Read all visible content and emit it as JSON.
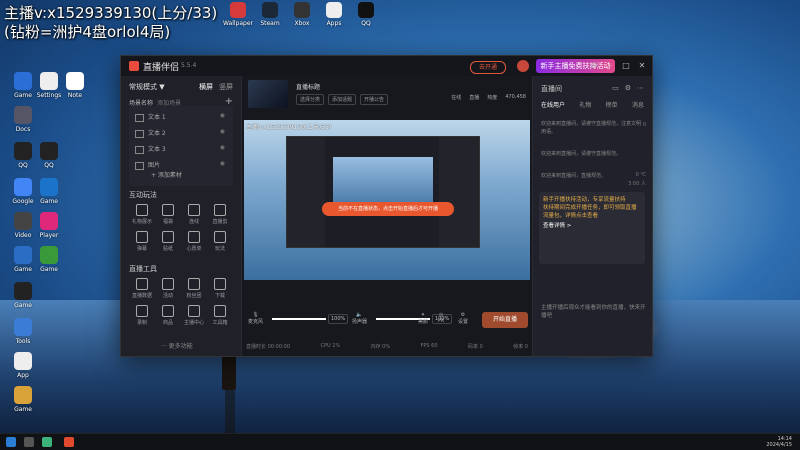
{
  "overlay": {
    "line1": "主播v:x1529339130(上分/33)",
    "line2": "(钻粉=洲护4盘orlol4局)"
  },
  "top_icons": [
    {
      "label": "Wallpaper"
    },
    {
      "label": "Steam"
    },
    {
      "label": "Xbox"
    },
    {
      "label": "Apps"
    },
    {
      "label": "QQ"
    }
  ],
  "desktop_icons": [
    {
      "label": "Game"
    },
    {
      "label": "Settings"
    },
    {
      "label": "Note"
    },
    {
      "label": "Docs"
    },
    {
      "label": "QQ"
    },
    {
      "label": "QQ"
    },
    {
      "label": "Google"
    },
    {
      "label": "Game"
    },
    {
      "label": "Video"
    },
    {
      "label": "Player"
    },
    {
      "label": "Game"
    },
    {
      "label": "Game"
    },
    {
      "label": "Game"
    },
    {
      "label": "Tools"
    },
    {
      "label": "App"
    },
    {
      "label": "Game"
    }
  ],
  "app": {
    "name": "直播伴侣",
    "version": "5.5.4",
    "upgrade": "去开通",
    "promo": "新手主播免费扶持活动",
    "left": {
      "tab_a": "常规模式 ▼",
      "tab_b": "横屏",
      "tab_c": "竖屏",
      "scene_header": "场景名称",
      "scene_header2": "添加场景",
      "sources": [
        {
          "label": "文本 1"
        },
        {
          "label": "文本 2"
        },
        {
          "label": "文本 3"
        },
        {
          "label": "图片"
        }
      ],
      "add_source": "+ 添加素材",
      "section1": "互动玩法",
      "section1_items": [
        {
          "label": "礼物展示"
        },
        {
          "label": "福袋"
        },
        {
          "label": "连线"
        },
        {
          "label": "直播剪"
        },
        {
          "label": "弹幕"
        },
        {
          "label": "贴纸"
        },
        {
          "label": "心愿单"
        },
        {
          "label": "玩法"
        }
      ],
      "section2": "直播工具",
      "section2_items": [
        {
          "label": "直播数据"
        },
        {
          "label": "活动"
        },
        {
          "label": "粉丝团"
        },
        {
          "label": "下载"
        },
        {
          "label": "录制"
        },
        {
          "label": "商品"
        },
        {
          "label": "主播中心"
        },
        {
          "label": "工具箱"
        }
      ],
      "more": "··· 更多功能"
    },
    "center": {
      "title": "直播标题",
      "tags": [
        "选择分类",
        "添加话题",
        "开播公告"
      ],
      "stats": [
        "在线",
        "直播",
        "热度",
        "470,458"
      ],
      "preview_text": "主播v:x1529339130(上分/33)",
      "toast": "当前不在直播状态，点击开始直播后才可开播",
      "mic": "麦克风",
      "speaker": "扬声器",
      "pct1": "100%",
      "pct2": "100%",
      "mic_level": 1.0,
      "speaker_level": 1.0,
      "btn_beauty": "美颜",
      "btn_pk": "PK",
      "btn_settings": "设置",
      "start": "开始直播",
      "foot": [
        "直播时长 00:00:00",
        "CPU 1%",
        "内存 0%",
        "FPS 60",
        "码率 0",
        "帧率 0"
      ]
    },
    "right": {
      "title": "直播间",
      "tabs": [
        "在线用户",
        "礼物",
        "榜单",
        "消息"
      ],
      "msgs": [
        {
          "text": "欢迎来到直播间，请遵守直播规范，注意文明用语。",
          "tail": "0"
        },
        {
          "text": "欢迎来到直播间，请遵守直播规范。"
        },
        {
          "text": "欢迎来到直播间，直播规范。",
          "tail": "0 ℃",
          "tail2": "3:00 人"
        }
      ],
      "card": [
        "新手开播扶持活动，专享流量扶持",
        "扶持期间完成开播任务，即可领取直播流量包，详情点击查看",
        "查看详情 >"
      ],
      "bottom": "主播开播后观众才能看到你的直播，快来开播吧"
    }
  },
  "taskbar": {
    "time": "14:14",
    "date": "2024/4/15"
  },
  "colors": {
    "accent": "#e05a3a",
    "start": "#a04b2e",
    "promo": "#8a2be2"
  }
}
